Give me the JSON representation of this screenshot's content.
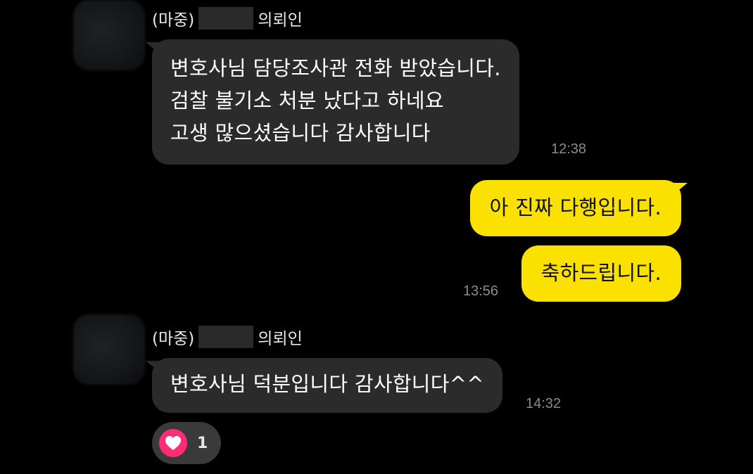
{
  "colors": {
    "background": "#000000",
    "incoming_bubble": "#2b2b2b",
    "outgoing_bubble": "#fae100",
    "timestamp": "#8b8b8b",
    "heart": "#ff2d76"
  },
  "messages": [
    {
      "sender": {
        "prefix": "(마중)",
        "suffix": "의뢰인"
      },
      "lines": [
        "변호사님 담당조사관 전화 받았습니다.",
        "검찰 불기소 처분 났다고 하네요",
        "고생 많으셨습니다 감사합니다"
      ],
      "time": "12:38"
    },
    {
      "outgoing": true,
      "bubbles": [
        {
          "text": "아 진짜 다행입니다."
        },
        {
          "text": "축하드립니다."
        }
      ],
      "time": "13:56"
    },
    {
      "sender": {
        "prefix": "(마중)",
        "suffix": "의뢰인"
      },
      "lines": [
        "변호사님 덕분입니다 감사합니다^^"
      ],
      "time": "14:32",
      "reaction": {
        "icon": "heart-icon",
        "count": "1"
      }
    }
  ]
}
